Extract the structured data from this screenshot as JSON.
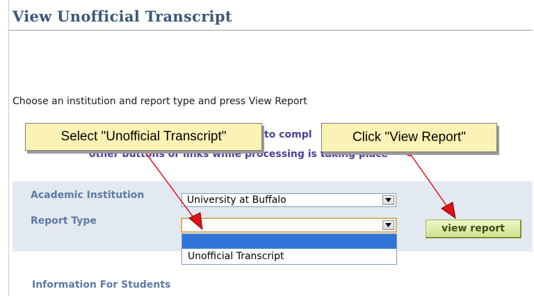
{
  "page": {
    "title": "View Unofficial Transcript",
    "instruction": "Choose an institution and report type and press View Report",
    "warning_line1": "to compl",
    "warning_line2": "other buttons or links while processing is taking place"
  },
  "form": {
    "institution_label": "Academic Institution",
    "institution_value": "University at Buffalo",
    "report_type_label": "Report Type",
    "report_type_value": "",
    "report_type_options": [
      "",
      "Unofficial Transcript"
    ],
    "view_report_button": "view report"
  },
  "section": {
    "info_heading": "Information For Students"
  },
  "callouts": {
    "select_hint": "Select \"Unofficial Transcript\"",
    "click_hint": "Click \"View Report\""
  },
  "colors": {
    "title": "#3d5679",
    "label": "#5b7aa7",
    "panel_bg": "#e3e9f0",
    "highlight": "#3074d8",
    "callout_bg": "#fbf3b5",
    "arrow": "#e0101a",
    "button_bg": "#cfe48c"
  }
}
